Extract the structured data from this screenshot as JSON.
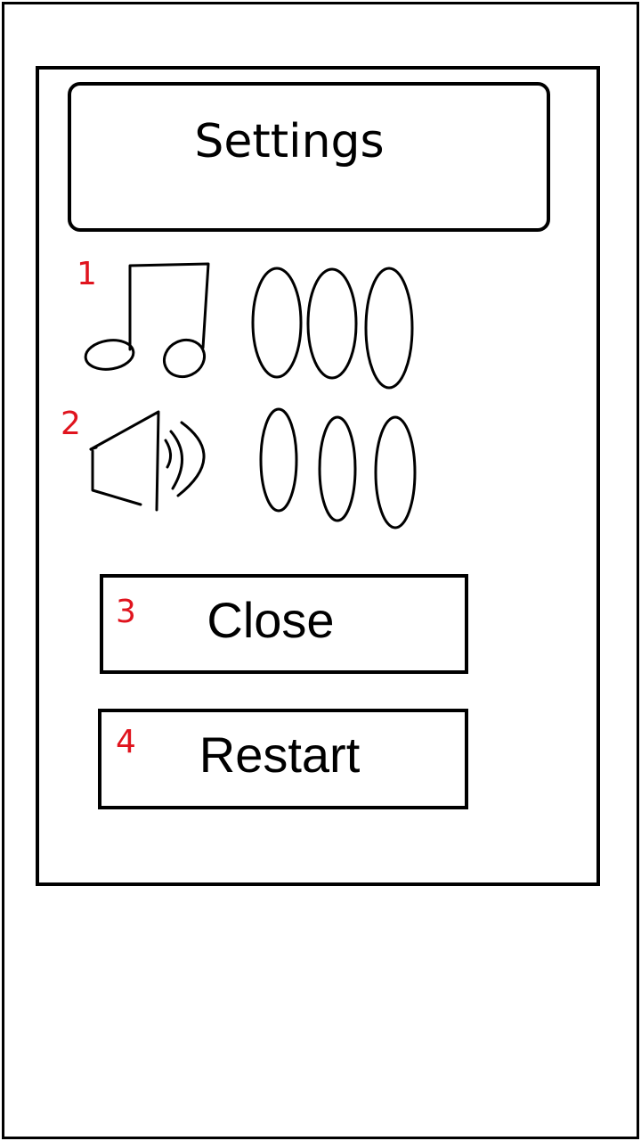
{
  "dialog": {
    "title": "Settings"
  },
  "settings": [
    {
      "marker": "1",
      "icon": "music-note-icon",
      "level_options": 3
    },
    {
      "marker": "2",
      "icon": "speaker-icon",
      "level_options": 3
    }
  ],
  "buttons": {
    "close": {
      "marker": "3",
      "label": "Close"
    },
    "restart": {
      "marker": "4",
      "label": "Restart"
    }
  },
  "colors": {
    "marker": "#e0141e",
    "ink": "#000000",
    "background": "#ffffff"
  }
}
